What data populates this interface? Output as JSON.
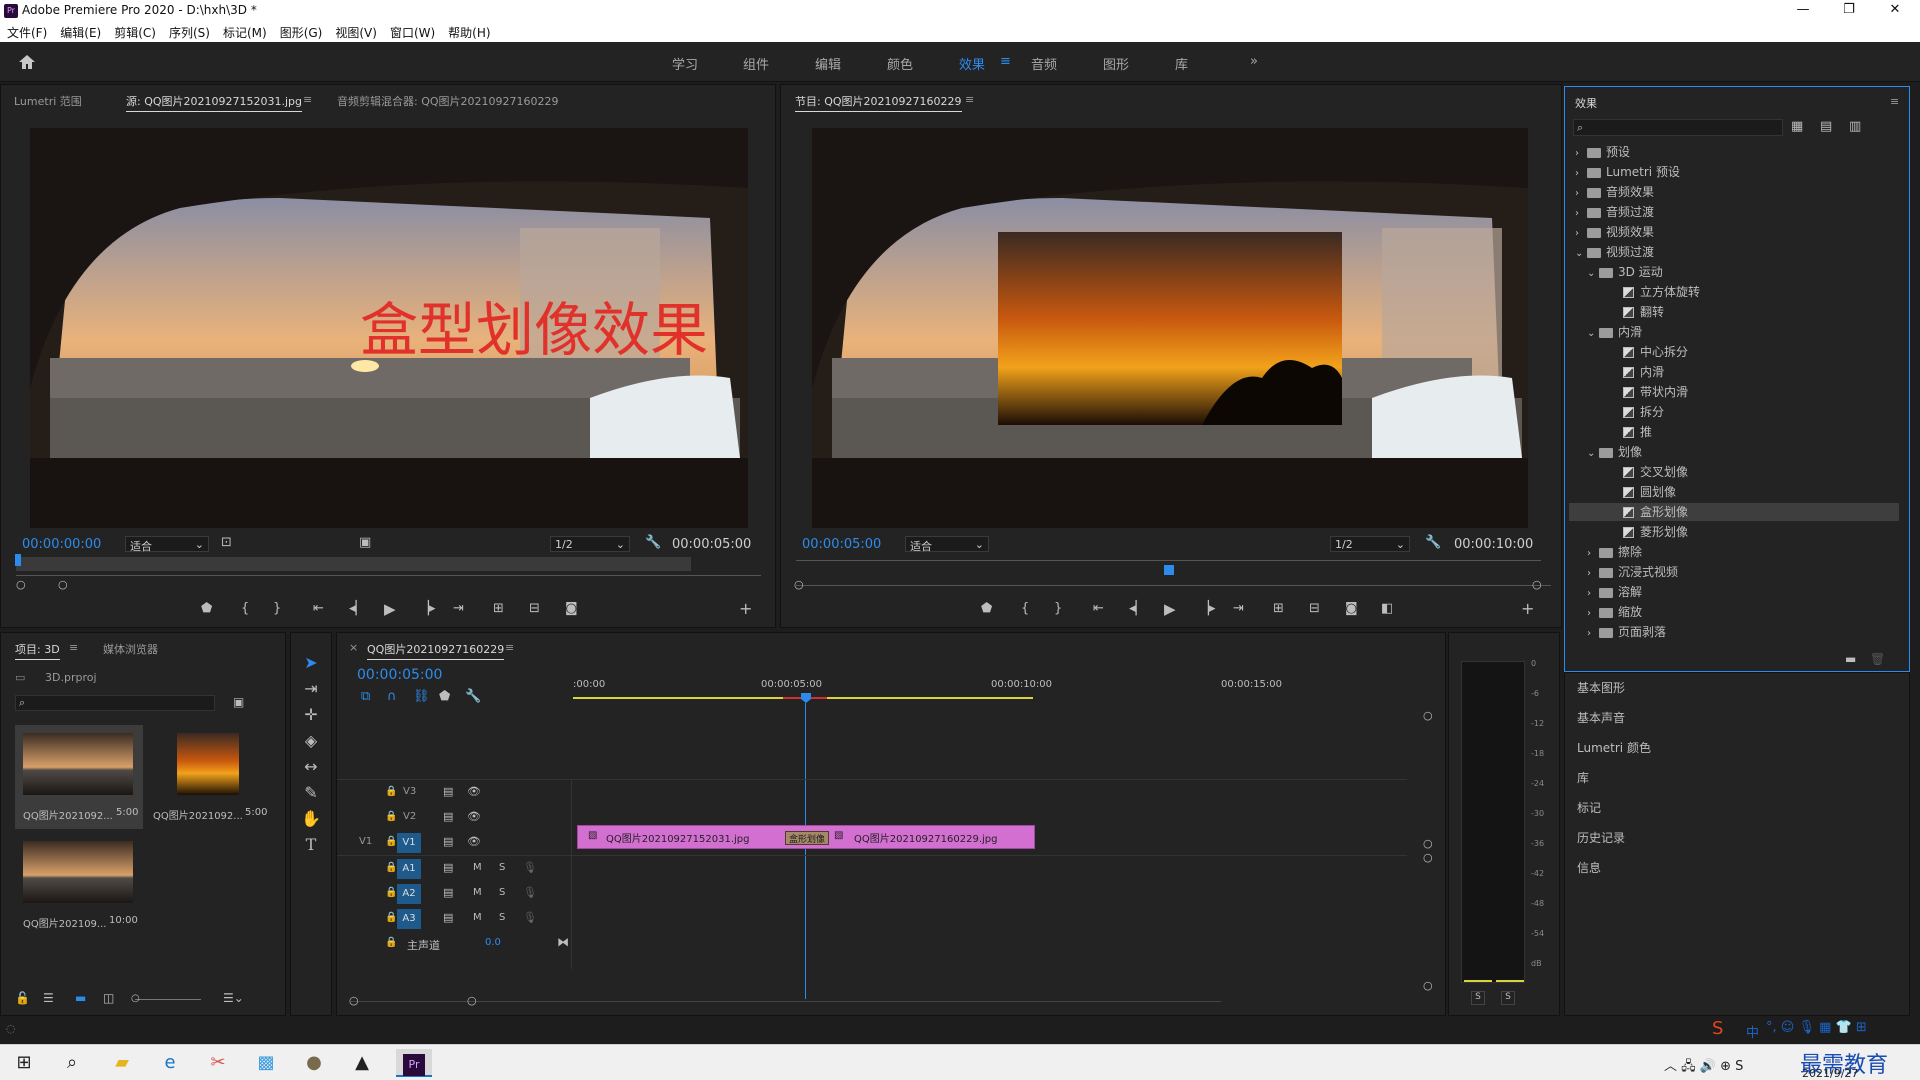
{
  "titlebar": {
    "title": "Adobe Premiere Pro 2020 - D:\\hxh\\3D *",
    "app_icon": "Pr",
    "minimize": "—",
    "maximize": "❐",
    "close": "✕"
  },
  "menu": [
    "文件(F)",
    "编辑(E)",
    "剪辑(C)",
    "序列(S)",
    "标记(M)",
    "图形(G)",
    "视图(V)",
    "窗口(W)",
    "帮助(H)"
  ],
  "workspaces": [
    "学习",
    "组件",
    "编辑",
    "颜色",
    "效果",
    "音频",
    "图形",
    "库"
  ],
  "workspace_active": "效果",
  "workspace_more": "»",
  "source_panel": {
    "tabs": [
      "Lumetri 范围",
      "源: QQ图片20210927152031.jpg",
      "音频剪辑混合器: QQ图片20210927160229"
    ],
    "overlay_text": "盒型划像效果",
    "timecode": "00:00:00:00",
    "fit": "适合",
    "resolution": "1/2",
    "duration": "00:00:05:00"
  },
  "program_panel": {
    "title": "节目: QQ图片20210927160229",
    "timecode": "00:00:05:00",
    "fit": "适合",
    "resolution": "1/2",
    "duration": "00:00:10:00"
  },
  "project_panel": {
    "tabs": [
      "项目: 3D",
      "媒体浏览器"
    ],
    "project_file": "3D.prproj",
    "items": [
      {
        "name": "QQ图片2021092...",
        "dur": "5:00"
      },
      {
        "name": "QQ图片2021092...",
        "dur": "5:00"
      },
      {
        "name": "QQ图片202109...",
        "dur": "10:00"
      }
    ]
  },
  "timeline": {
    "title": "QQ图片20210927160229",
    "timecode": "00:00:05:00",
    "ruler": [
      ":00:00",
      "00:00:05:00",
      "00:00:10:00",
      "00:00:15:00"
    ],
    "tracks": [
      "V3",
      "V2",
      "V1",
      "A1",
      "A2",
      "A3"
    ],
    "master_label": "主声道",
    "master_value": "0.0",
    "clip1": "QQ图片20210927152031.jpg",
    "clip2": "QQ图片20210927160229.jpg",
    "transition": "盒形划像"
  },
  "meter": {
    "scale": [
      "0",
      "-6",
      "-12",
      "-18",
      "-24",
      "-30",
      "-36",
      "-42",
      "-48",
      "-54",
      "dB"
    ],
    "solo": [
      "S",
      "S"
    ]
  },
  "effects": {
    "title": "效果",
    "tree": [
      {
        "label": "预设",
        "level": 0,
        "type": "folder",
        "open": false
      },
      {
        "label": "Lumetri 预设",
        "level": 0,
        "type": "folder",
        "open": false
      },
      {
        "label": "音频效果",
        "level": 0,
        "type": "folder",
        "open": false
      },
      {
        "label": "音频过渡",
        "level": 0,
        "type": "folder",
        "open": false
      },
      {
        "label": "视频效果",
        "level": 0,
        "type": "folder",
        "open": false
      },
      {
        "label": "视频过渡",
        "level": 0,
        "type": "folder",
        "open": true
      },
      {
        "label": "3D 运动",
        "level": 1,
        "type": "folder",
        "open": true
      },
      {
        "label": "立方体旋转",
        "level": 2,
        "type": "fx"
      },
      {
        "label": "翻转",
        "level": 2,
        "type": "fx"
      },
      {
        "label": "内滑",
        "level": 1,
        "type": "folder",
        "open": true
      },
      {
        "label": "中心拆分",
        "level": 2,
        "type": "fx"
      },
      {
        "label": "内滑",
        "level": 2,
        "type": "fx"
      },
      {
        "label": "带状内滑",
        "level": 2,
        "type": "fx"
      },
      {
        "label": "拆分",
        "level": 2,
        "type": "fx"
      },
      {
        "label": "推",
        "level": 2,
        "type": "fx"
      },
      {
        "label": "划像",
        "level": 1,
        "type": "folder",
        "open": true
      },
      {
        "label": "交叉划像",
        "level": 2,
        "type": "fx"
      },
      {
        "label": "圆划像",
        "level": 2,
        "type": "fx"
      },
      {
        "label": "盒形划像",
        "level": 2,
        "type": "fx",
        "selected": true
      },
      {
        "label": "菱形划像",
        "level": 2,
        "type": "fx"
      },
      {
        "label": "擦除",
        "level": 1,
        "type": "folder",
        "open": false
      },
      {
        "label": "沉浸式视频",
        "level": 1,
        "type": "folder",
        "open": false
      },
      {
        "label": "溶解",
        "level": 1,
        "type": "folder",
        "open": false
      },
      {
        "label": "缩放",
        "level": 1,
        "type": "folder",
        "open": false
      },
      {
        "label": "页面剥落",
        "level": 1,
        "type": "folder",
        "open": false
      }
    ]
  },
  "side_panels": [
    "基本图形",
    "基本声音",
    "Lumetri 颜色",
    "库",
    "标记",
    "历史记录",
    "信息"
  ],
  "taskbar": {
    "date": "2021/9/27",
    "brand": "最需教育",
    "ime": "中"
  }
}
